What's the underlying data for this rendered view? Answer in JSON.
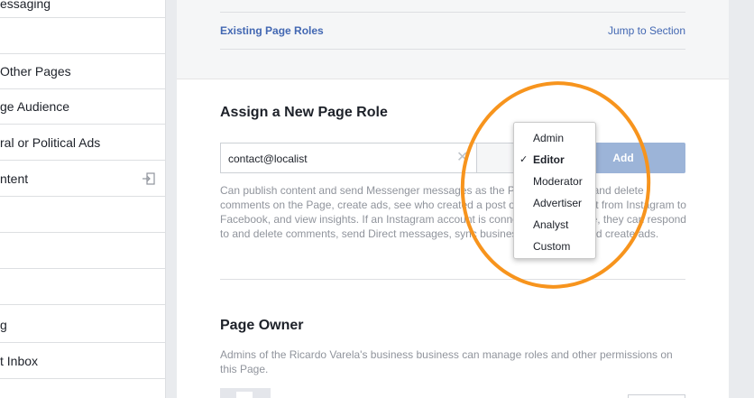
{
  "sidebar": {
    "items": [
      {
        "label": "essaging",
        "icon": null
      },
      {
        "label": "",
        "icon": null
      },
      {
        "label": "Other Pages",
        "icon": null
      },
      {
        "label": "ge Audience",
        "icon": null
      },
      {
        "label": "ral or Political Ads",
        "icon": null
      },
      {
        "label": "ntent",
        "icon": "enter-icon"
      },
      {
        "label": "",
        "icon": null
      },
      {
        "label": "",
        "icon": null
      },
      {
        "label": "",
        "icon": null
      },
      {
        "label": "g",
        "icon": null
      },
      {
        "label": "t Inbox",
        "icon": null
      }
    ]
  },
  "existing": {
    "title": "Existing Page Roles",
    "jump": "Jump to Section"
  },
  "assign": {
    "heading": "Assign a New Page Role",
    "input_value": "contact@localist",
    "clear_symbol": "✕",
    "add_label": "Add",
    "description": "Can publish content and send Messenger messages as the Page, respond to and delete comments on the Page, create ads, see who created a post or comment, boost from Instagram to Facebook, and view insights. If an Instagram account is connected to the Page, they can respond to and delete comments, send Direct messages, sync business contact info and create ads."
  },
  "role_dropdown": {
    "selected": "Editor",
    "check_symbol": "✓",
    "options": [
      "Admin",
      "Editor",
      "Moderator",
      "Advertiser",
      "Analyst",
      "Custom"
    ]
  },
  "owner": {
    "heading": "Page Owner",
    "description": "Admins of the Ricardo Varela's business business can manage roles and other permissions on this Page."
  },
  "colors": {
    "link": "#4267b2",
    "add_button": "#9cb4d8",
    "highlight": "#f7941d"
  }
}
